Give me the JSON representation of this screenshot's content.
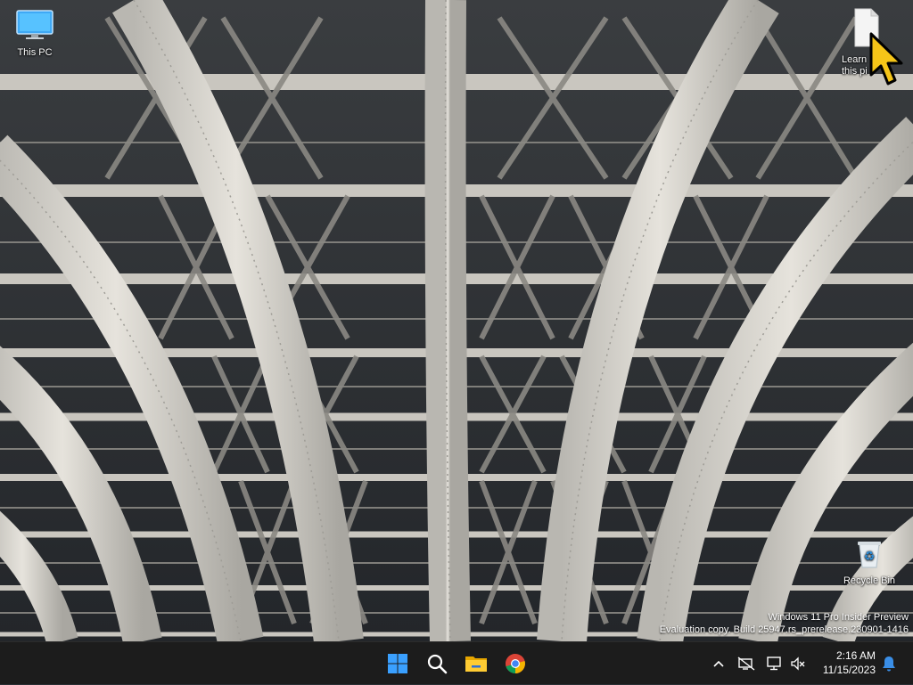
{
  "desktop": {
    "icons": [
      {
        "label": "This PC",
        "icon": "this-pc-icon"
      },
      {
        "label": "Learn about\nthis picture",
        "visible_label_line1": "Learn",
        "visible_label_line2": "this pi",
        "icon": "document-icon"
      },
      {
        "label": "Recycle Bin",
        "icon": "recycle-bin-icon"
      }
    ]
  },
  "watermark": {
    "line1": "Windows 11 Pro Insider Preview",
    "line2": "Evaluation copy. Build 25947.rs_prerelease.230901-1416"
  },
  "taskbar": {
    "apps": [
      {
        "name": "Start",
        "icon": "windows-start-icon",
        "color": "#1e90ff"
      },
      {
        "name": "Search",
        "icon": "search-icon"
      },
      {
        "name": "File Explorer",
        "icon": "file-explorer-icon",
        "color": "#f2b705"
      },
      {
        "name": "Google Chrome",
        "icon": "chrome-icon"
      }
    ],
    "tray": {
      "chevron_icon": "chevron-up-icon",
      "network_icon": "network-disconnected-icon",
      "display_icon": "display-icon",
      "volume_icon": "volume-muted-icon",
      "notification_icon": "bell-icon",
      "accent_color": "#3a8ee6"
    },
    "clock": {
      "time": "2:16 AM",
      "date": "11/15/2023"
    }
  }
}
